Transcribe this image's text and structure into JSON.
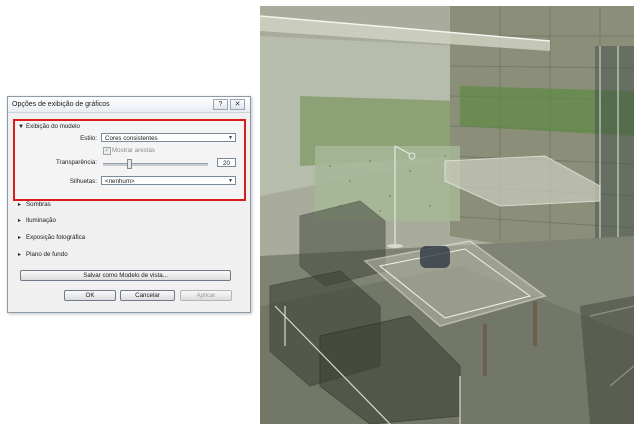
{
  "dialog": {
    "title": "Opções de exibição de gráficos",
    "help_icon": "?",
    "close_icon": "✕",
    "model_section": {
      "header": "Exibição do modelo",
      "style_label": "Estilo:",
      "style_value": "Cores consistentes",
      "show_edges_label": "Mostrar arestas",
      "show_edges_checked": true,
      "transparency_label": "Transparência:",
      "transparency_value": "20",
      "silhouettes_label": "Silhuetas:",
      "silhouettes_value": "<nenhum>"
    },
    "sections": [
      {
        "label": "Sombras"
      },
      {
        "label": "Iluminação"
      },
      {
        "label": "Exposição fotográfica"
      },
      {
        "label": "Plano de fundo"
      }
    ],
    "save_button": "Salvar como Modelo de vista...",
    "ok_button": "OK",
    "cancel_button": "Cancelar",
    "apply_button": "Aplicar"
  },
  "colors": {
    "highlight_border": "#d91c1c",
    "viewport_bg": "#a5a89a"
  }
}
